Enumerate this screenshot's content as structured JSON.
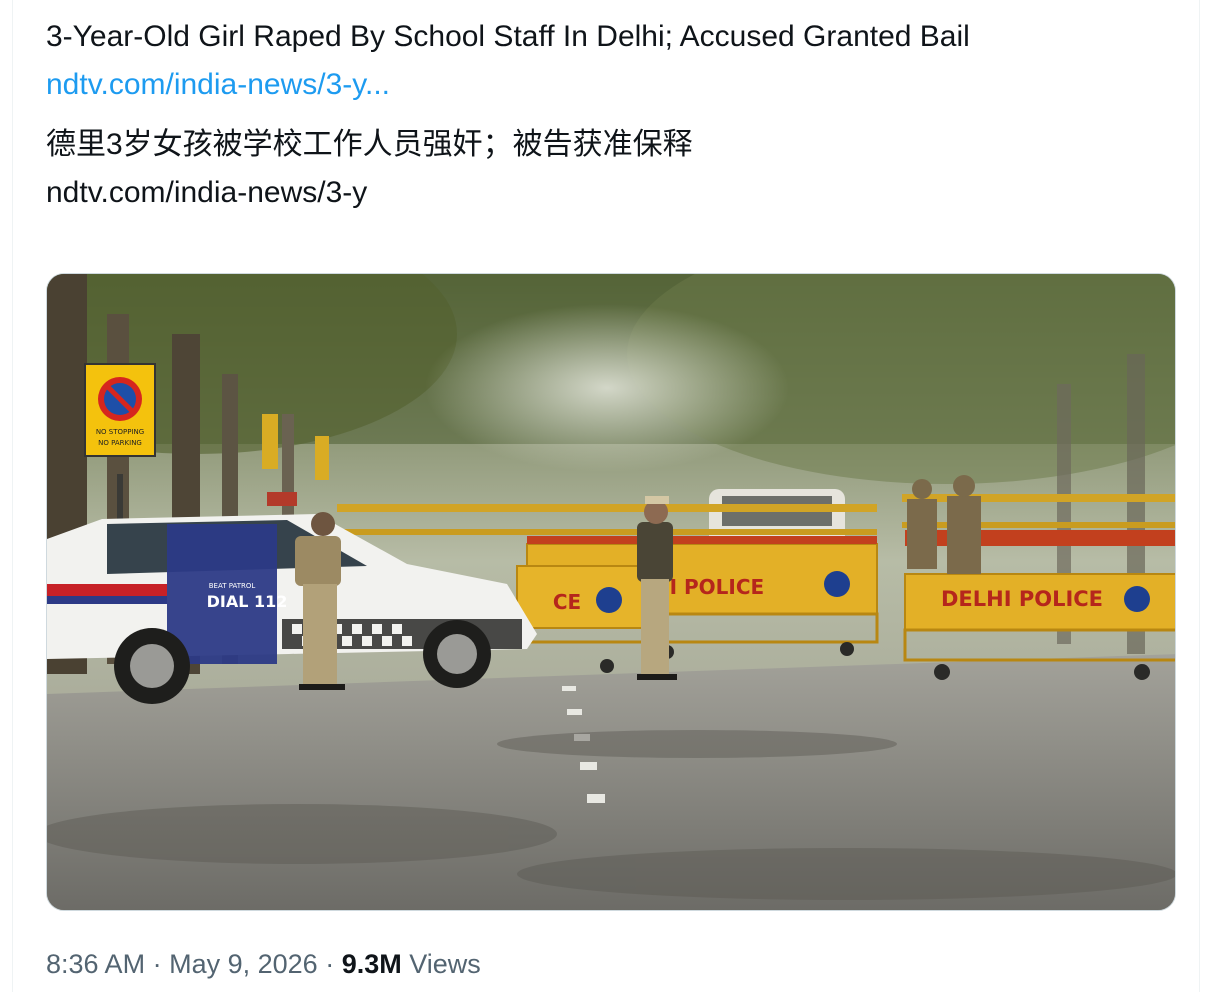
{
  "tweet": {
    "headline": "3-Year-Old Girl Raped By School Staff In Delhi; Accused Granted Bail",
    "link_display": "ndtv.com/india-news/3-y...",
    "translation": "德里3岁女孩被学校工作人员强奸；被告获准保释",
    "translation_link": "ndtv.com/india-news/3-y",
    "time": "8:36 AM",
    "separator": "·",
    "date": "May 9, 2026",
    "views_count": "9.3M",
    "views_label": "Views"
  },
  "photo": {
    "car_text": "DIAL 112",
    "car_sub": "BEAT PATROL",
    "barricade_left_text": "CE",
    "barricade_mid_text": "DELHI POLICE",
    "barricade_right_text": "DELHI POLICE",
    "sign_text_1": "NO STOPPING",
    "sign_text_2": "NO PARKING"
  }
}
